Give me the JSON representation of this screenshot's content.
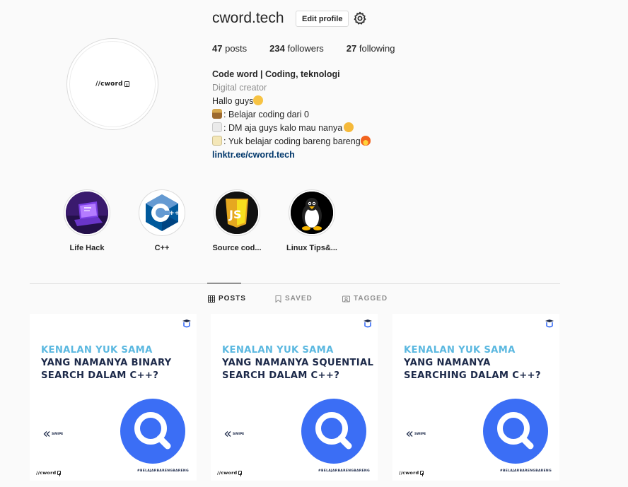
{
  "profile": {
    "username": "cword.tech",
    "edit_label": "Edit profile",
    "avatar_brand": "//cword",
    "stats": [
      {
        "count": "47",
        "label": "posts"
      },
      {
        "count": "234",
        "label": "followers"
      },
      {
        "count": "27",
        "label": "following"
      }
    ],
    "bio": {
      "name": "Code word | Coding, teknologi",
      "category": "Digital creator",
      "line1": "Hallo guys",
      "line2": ": Belajar coding dari 0",
      "line3": ": DM aja guys kalo mau nanya",
      "line4": ": Yuk belajar coding bareng bareng",
      "link": "linktr.ee/cword.tech"
    }
  },
  "highlights": [
    {
      "label": "Life Hack",
      "icon": "laptop-icon"
    },
    {
      "label": "C++",
      "icon": "cpp-logo-icon"
    },
    {
      "label": "Source cod...",
      "icon": "js-logo-icon"
    },
    {
      "label": "Linux Tips&...",
      "icon": "linux-penguin-icon"
    }
  ],
  "tabs": [
    {
      "label": "POSTS",
      "icon": "grid-icon",
      "active": true
    },
    {
      "label": "SAVED",
      "icon": "bookmark-icon",
      "active": false
    },
    {
      "label": "TAGGED",
      "icon": "tag-icon",
      "active": false
    }
  ],
  "posts": [
    {
      "line1": "KENALAN YUK SAMA",
      "rest": "YANG NAMANYA BINARY SEARCH DALAM C++?",
      "swipe": "SWIPE",
      "hashtag": "#BELAJARBARENGBARENG",
      "brand": "//cword"
    },
    {
      "line1": "KENALAN YUK SAMA",
      "rest": "YANG NAMANYA SQUENTIAL SEARCH DALAM C++?",
      "swipe": "SWIPE",
      "hashtag": "#BELAJARBARENGBARENG",
      "brand": "//cword"
    },
    {
      "line1": "KENALAN YUK SAMA",
      "rest": "YANG NAMANYA SEARCHING DALAM C++?",
      "swipe": "SWIPE",
      "hashtag": "#BELAJARBARENGBARENG",
      "brand": "//cword"
    }
  ],
  "colors": {
    "accent_blue": "#3b6ef5",
    "title_light_blue": "#5bb8e0",
    "title_dark": "#1d2a4a",
    "link": "#00376b"
  }
}
